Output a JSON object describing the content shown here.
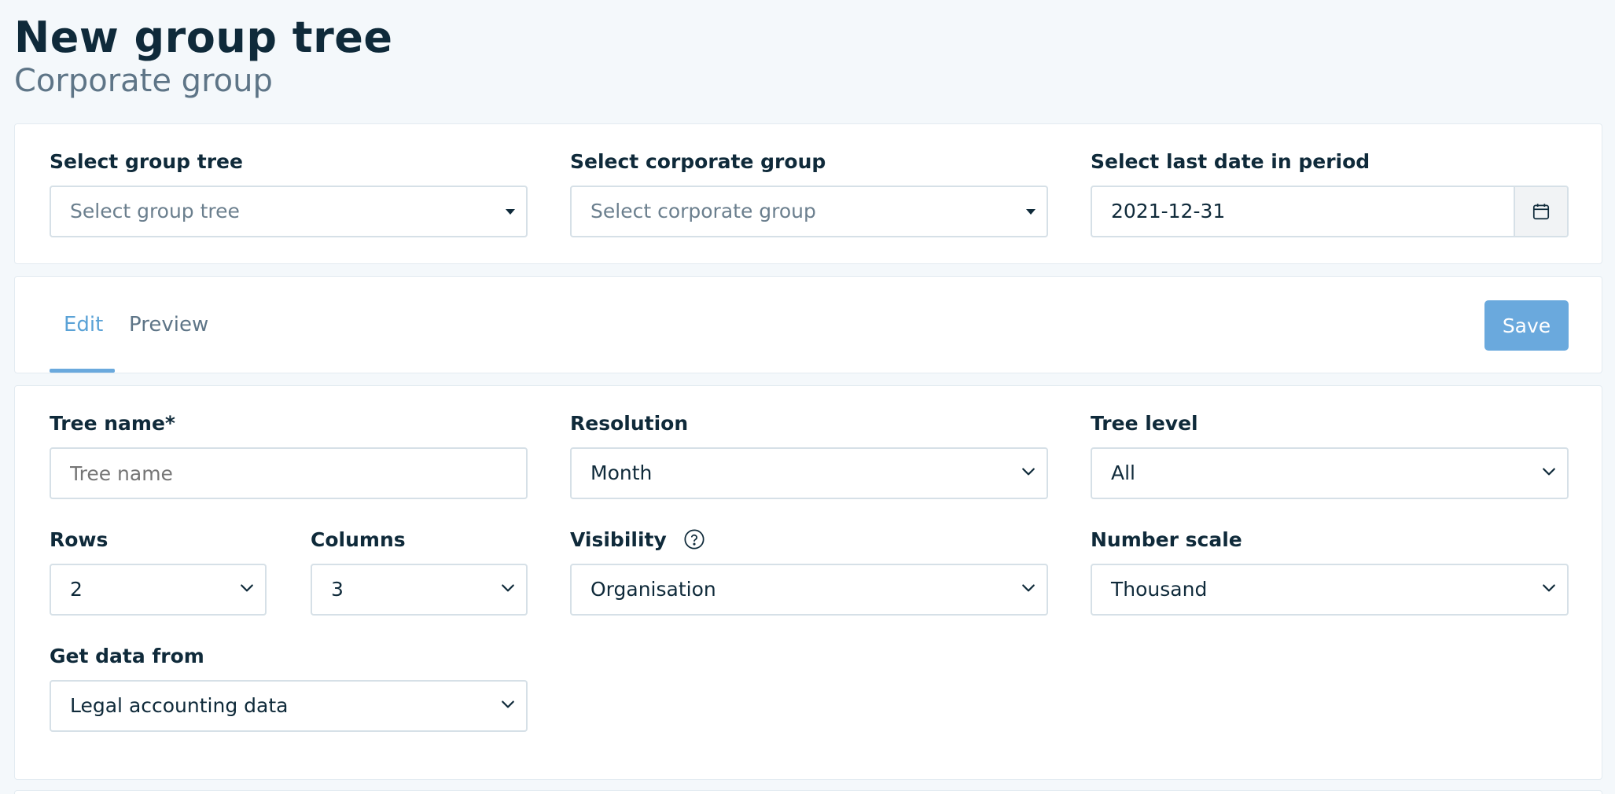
{
  "header": {
    "title": "New group tree",
    "subtitle": "Corporate group"
  },
  "selectors": {
    "group_tree": {
      "label": "Select group tree",
      "placeholder": "Select group tree"
    },
    "corporate_group": {
      "label": "Select corporate group",
      "placeholder": "Select corporate group"
    },
    "last_date": {
      "label": "Select last date in period",
      "value": "2021-12-31",
      "icon": "calendar-icon"
    }
  },
  "tabs": {
    "items": [
      {
        "label": "Edit",
        "active": true
      },
      {
        "label": "Preview",
        "active": false
      }
    ],
    "save_label": "Save",
    "accent_color": "#6aa9dd"
  },
  "form": {
    "tree_name": {
      "label": "Tree name*",
      "placeholder": "Tree name"
    },
    "resolution": {
      "label": "Resolution",
      "value": "Month"
    },
    "tree_level": {
      "label": "Tree level",
      "value": "All"
    },
    "rows": {
      "label": "Rows",
      "value": "2"
    },
    "columns": {
      "label": "Columns",
      "value": "3"
    },
    "visibility": {
      "label": "Visibility",
      "value": "Organisation",
      "icon": "help-circle-icon"
    },
    "number_scale": {
      "label": "Number scale",
      "value": "Thousand"
    },
    "data_source": {
      "label": "Get data from",
      "value": "Legal accounting data"
    }
  }
}
